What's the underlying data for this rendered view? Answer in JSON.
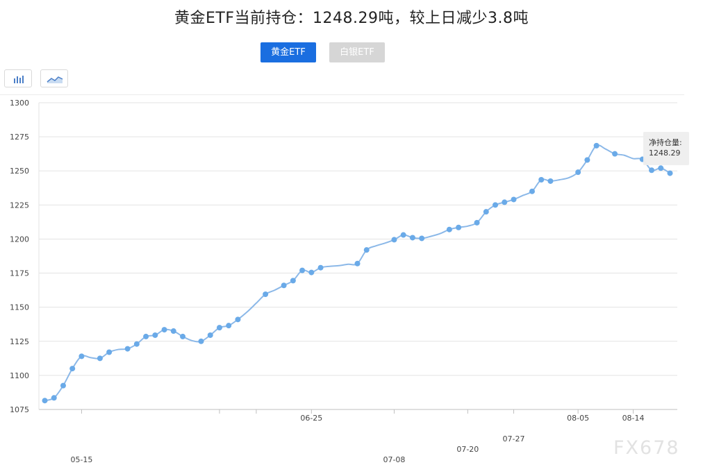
{
  "title": "黄金ETF当前持仓：1248.29吨，较上日减少3.8吨",
  "buttons": {
    "gold": "黄金ETF",
    "silver": "白银ETF"
  },
  "toolbar": {
    "bar_icon": "bar-chart-icon",
    "line_icon": "line-chart-icon"
  },
  "tooltip": {
    "label": "净持仓量:",
    "value": "1248.29"
  },
  "watermark": "FX678",
  "colors": {
    "line": "#8bb8e8",
    "point": "#6aaae8",
    "active_button": "#1a6ee0",
    "inactive_button": "#d6d6d6"
  },
  "chart_data": {
    "type": "line",
    "title": "",
    "xlabel": "",
    "ylabel": "",
    "ylim": [
      1075,
      1300
    ],
    "yticks": [
      1075,
      1100,
      1125,
      1150,
      1175,
      1200,
      1225,
      1250,
      1275,
      1300
    ],
    "grid": true,
    "x_labels": [
      {
        "index": 4,
        "label": "05-15",
        "row": 1
      },
      {
        "index": 29,
        "label": "06-25",
        "row": 0
      },
      {
        "index": 38,
        "label": "07-08",
        "row": 1
      },
      {
        "index": 46,
        "label": "07-20",
        "row": 2
      },
      {
        "index": 51,
        "label": "07-27",
        "row": 3
      },
      {
        "index": 58,
        "label": "08-05",
        "row": 0
      },
      {
        "index": 64,
        "label": "08-14",
        "row": 4
      }
    ],
    "series": [
      {
        "values": [
          1081.5,
          1083.5,
          1092.5,
          1105,
          1114,
          1113,
          1112.5,
          1117,
          1119,
          1119.5,
          1123,
          1128.5,
          1129.5,
          1133.5,
          1132.5,
          1128.5,
          1125.5,
          1125,
          1129.5,
          1135,
          1136.5,
          1141,
          1146.5,
          1153,
          1159.5,
          1162.5,
          1166,
          1169.5,
          1177,
          1175.5,
          1179,
          1180,
          1180.5,
          1181.5,
          1182,
          1192,
          1195,
          1197,
          1199.5,
          1203,
          1201,
          1200.5,
          1202,
          1204,
          1207,
          1208.5,
          1209.5,
          1212,
          1220,
          1225,
          1227,
          1229,
          1232,
          1235,
          1243.5,
          1242.5,
          1243.5,
          1245,
          1249,
          1258,
          1268.5,
          1266,
          1262.5,
          1261.5,
          1259,
          1258.5,
          1250.5,
          1252,
          1248.29
        ],
        "markers": [
          0,
          1,
          2,
          3,
          4,
          6,
          7,
          9,
          10,
          11,
          12,
          13,
          14,
          15,
          17,
          18,
          19,
          20,
          21,
          24,
          26,
          27,
          28,
          29,
          30,
          34,
          35,
          38,
          39,
          40,
          41,
          44,
          45,
          47,
          48,
          49,
          50,
          51,
          53,
          54,
          55,
          58,
          59,
          60,
          62,
          65,
          66,
          67,
          68
        ]
      }
    ]
  }
}
